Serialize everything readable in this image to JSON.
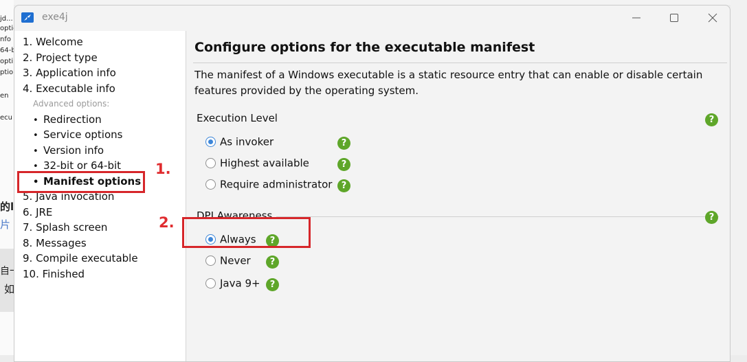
{
  "background": {
    "fragments": [
      "jd...",
      "optic",
      "nfo",
      "64-b",
      "opti",
      "ption",
      "en",
      "ecu"
    ],
    "bold_fragment": "的l",
    "blue_fragment": "片",
    "lower_fragments": [
      "自一",
      "如"
    ]
  },
  "window": {
    "title": "exe4j",
    "controls": {
      "minimize": "minimize-icon",
      "maximize": "maximize-icon",
      "close": "close-icon"
    }
  },
  "sidebar": {
    "steps_top": [
      "1. Welcome",
      "2. Project type",
      "3. Application info",
      "4. Executable info"
    ],
    "advanced_label": "Advanced options:",
    "advanced_items": [
      "Redirection",
      "Service options",
      "Version info",
      "32-bit or 64-bit",
      "Manifest options"
    ],
    "active_item": "Manifest options",
    "bullet": "•",
    "steps_bottom": [
      "5. Java invocation",
      "6. JRE",
      "7. Splash screen",
      "8. Messages",
      "9. Compile executable",
      "10. Finished"
    ]
  },
  "main": {
    "heading": "Configure options for the executable manifest",
    "description": "The manifest of a Windows executable is a static resource entry that can enable or disable certain features provided by the operating system.",
    "execution_level": {
      "title": "Execution Level",
      "options": [
        "As invoker",
        "Highest available",
        "Require administrator"
      ],
      "selected": "As invoker"
    },
    "dpi_awareness": {
      "title": "DPI Awareness",
      "options": [
        "Always",
        "Never",
        "Java 9+"
      ],
      "selected": "Always"
    },
    "help_glyph": "?"
  },
  "annotations": {
    "first": "1.",
    "second": "2."
  },
  "colors": {
    "accent": "#3d86d8",
    "help_green": "#5ea629",
    "annotation_red": "#d6262a"
  }
}
